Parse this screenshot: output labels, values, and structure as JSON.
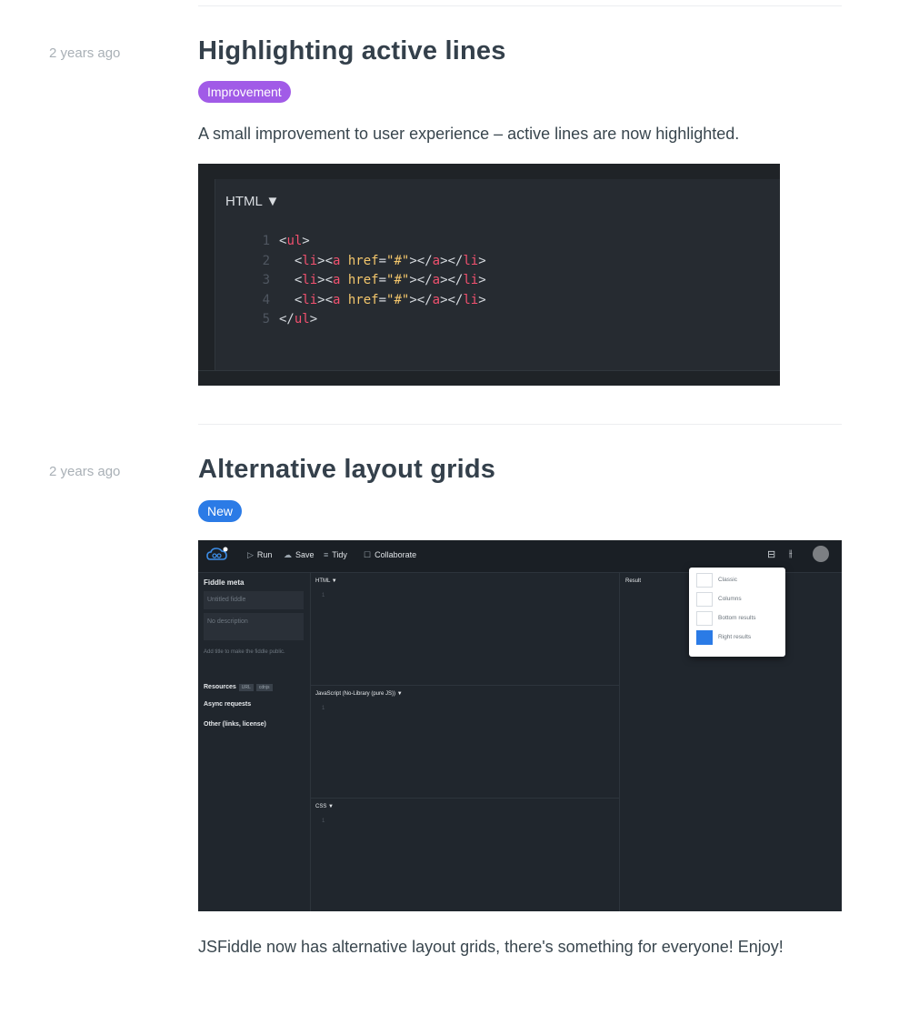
{
  "entries": [
    {
      "time": "2 years ago",
      "title": "Highlighting active lines",
      "badge": "Improvement",
      "description": "A small improvement to user experience – active lines are now highlighted.",
      "code_panel": {
        "language": "HTML ▼",
        "lines": [
          {
            "n": "1",
            "indent": "",
            "parts": [
              [
                "p",
                "<"
              ],
              [
                "t",
                "ul"
              ],
              [
                "p",
                ">"
              ]
            ]
          },
          {
            "n": "2",
            "indent": "  ",
            "parts": [
              [
                "p",
                "<"
              ],
              [
                "t",
                "li"
              ],
              [
                "p",
                "><"
              ],
              [
                "t",
                "a"
              ],
              [
                "a",
                " href"
              ],
              [
                "p",
                "="
              ],
              [
                "s",
                "\"#\""
              ],
              [
                "p",
                "></"
              ],
              [
                "t",
                "a"
              ],
              [
                "p",
                "></"
              ],
              [
                "t",
                "li"
              ],
              [
                "p",
                ">"
              ]
            ]
          },
          {
            "n": "3",
            "indent": "  ",
            "parts": [
              [
                "p",
                "<"
              ],
              [
                "t",
                "li"
              ],
              [
                "p",
                "><"
              ],
              [
                "t",
                "a"
              ],
              [
                "a",
                " href"
              ],
              [
                "p",
                "="
              ],
              [
                "s",
                "\"#\""
              ],
              [
                "p",
                "></"
              ],
              [
                "t",
                "a"
              ],
              [
                "p",
                "></"
              ],
              [
                "t",
                "li"
              ],
              [
                "p",
                ">"
              ]
            ]
          },
          {
            "n": "4",
            "indent": "  ",
            "parts": [
              [
                "p",
                "<"
              ],
              [
                "t",
                "li"
              ],
              [
                "p",
                "><"
              ],
              [
                "t",
                "a"
              ],
              [
                "a",
                " href"
              ],
              [
                "p",
                "="
              ],
              [
                "s",
                "\"#\""
              ],
              [
                "p",
                "></"
              ],
              [
                "t",
                "a"
              ],
              [
                "p",
                "></"
              ],
              [
                "t",
                "li"
              ],
              [
                "p",
                ">"
              ]
            ]
          },
          {
            "n": "5",
            "indent": "",
            "parts": [
              [
                "p",
                "</"
              ],
              [
                "t",
                "ul"
              ],
              [
                "p",
                ">"
              ]
            ]
          }
        ]
      }
    },
    {
      "time": "2 years ago",
      "title": "Alternative layout grids",
      "badge": "New",
      "description": "JSFiddle now has alternative layout grids, there's something for everyone! Enjoy!",
      "app": {
        "toolbar": {
          "run": "Run",
          "save": "Save",
          "tidy": "Tidy",
          "collaborate": "Collaborate"
        },
        "sidebar": {
          "heading": "Fiddle meta",
          "title_placeholder": "Untitled fiddle",
          "desc_placeholder": "No description",
          "note": "Add title to make the fiddle public.",
          "resources": "Resources",
          "chip_url": "URL",
          "chip_cdnjs": "cdnjs",
          "async": "Async requests",
          "other": "Other (links, license)"
        },
        "panels": {
          "html": "HTML ▼",
          "js": "JavaScript (No-Library (pure JS)) ▼",
          "css": "CSS ▼",
          "line": "1",
          "result": "Result"
        },
        "layout_menu": [
          "Classic",
          "Columns",
          "Bottom results",
          "Right results"
        ]
      }
    }
  ]
}
